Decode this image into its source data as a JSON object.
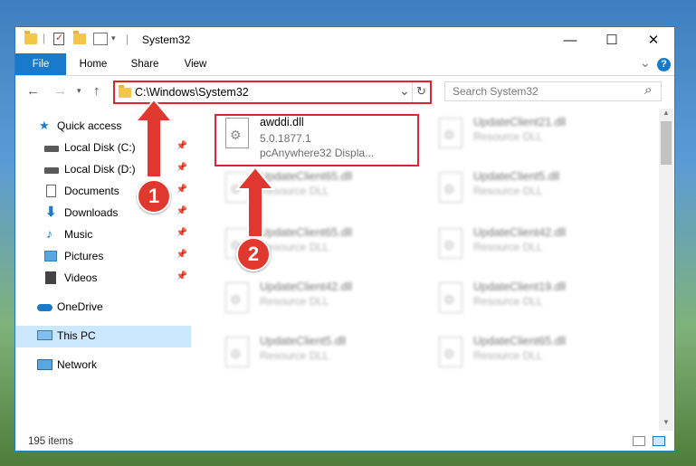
{
  "window": {
    "title": "System32",
    "controls": {
      "minimize": "—",
      "maximize": "☐",
      "close": "✕"
    }
  },
  "ribbon": {
    "tabs": [
      "File",
      "Home",
      "Share",
      "View"
    ],
    "expand": "⌄",
    "help": "?"
  },
  "address": {
    "path": "C:\\Windows\\System32",
    "dropdown": "⌄",
    "refresh": "↻"
  },
  "search": {
    "placeholder": "Search System32",
    "icon": "⌕"
  },
  "nav": {
    "items": [
      {
        "label": "Quick access",
        "icon": "star-icon",
        "pinned": false
      },
      {
        "label": "Local Disk (C:)",
        "icon": "drive-icon",
        "pinned": true
      },
      {
        "label": "Local Disk (D:)",
        "icon": "drive-icon",
        "pinned": true
      },
      {
        "label": "Documents",
        "icon": "documents-icon",
        "pinned": true
      },
      {
        "label": "Downloads",
        "icon": "downloads-icon",
        "pinned": true
      },
      {
        "label": "Music",
        "icon": "music-icon",
        "pinned": true
      },
      {
        "label": "Pictures",
        "icon": "pictures-icon",
        "pinned": true
      },
      {
        "label": "Videos",
        "icon": "videos-icon",
        "pinned": true
      },
      {
        "label": "OneDrive",
        "icon": "cloud-icon",
        "pinned": false
      },
      {
        "label": "This PC",
        "icon": "computer-icon",
        "pinned": false,
        "selected": true
      },
      {
        "label": "Network",
        "icon": "network-icon",
        "pinned": false
      }
    ],
    "pin_glyph": "📌"
  },
  "files": {
    "highlighted": {
      "name": "awddi.dll",
      "version": "5.0.1877.1",
      "description": "pcAnywhere32 Displa..."
    },
    "blurred": [
      {
        "name": "UpdateClient21.dll",
        "type": "Resource DLL"
      },
      {
        "name": "UpdateClient65.dll",
        "type": "Resource DLL"
      },
      {
        "name": "UpdateClient5.dll",
        "type": "Resource DLL"
      },
      {
        "name": "UpdateClient65.dll",
        "type": "Resource DLL"
      },
      {
        "name": "UpdateClient42.dll",
        "type": "Resource DLL"
      },
      {
        "name": "UpdateClient42.dll",
        "type": "Resource DLL"
      },
      {
        "name": "UpdateClient19.dll",
        "type": "Resource DLL"
      },
      {
        "name": "UpdateClient5.dll",
        "type": "Resource DLL"
      },
      {
        "name": "UpdateClient65.dll",
        "type": "Resource DLL"
      }
    ]
  },
  "status": {
    "count": "195 items"
  },
  "annotations": {
    "step1": "1",
    "step2": "2"
  },
  "colors": {
    "accent": "#1979ca",
    "highlight": "#d42a2a",
    "selection": "#cce8ff"
  }
}
